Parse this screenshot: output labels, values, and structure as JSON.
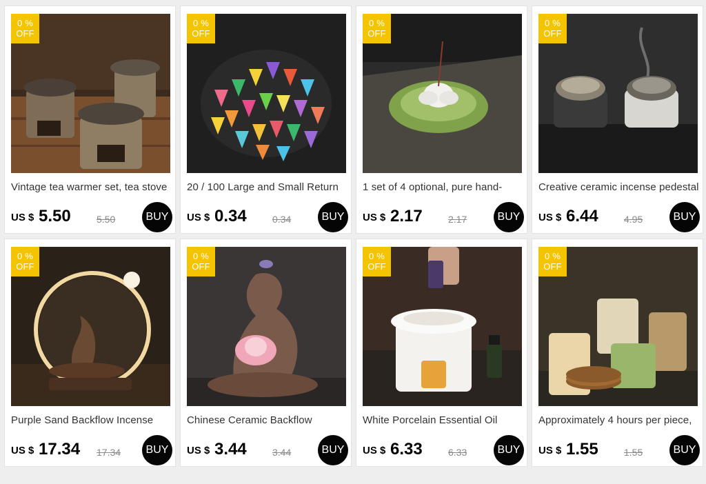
{
  "products": [
    {
      "badge_pct": "0 %",
      "badge_off": "OFF",
      "title": "Vintage tea warmer set, tea stove",
      "currency": "US $",
      "price": "5.50",
      "old_price": "5.50",
      "buy": "BUY",
      "image": "tea-warmer-set-image"
    },
    {
      "badge_pct": "0 %",
      "badge_off": "OFF",
      "title": "20 / 100 Large and Small Return",
      "currency": "US $",
      "price": "0.34",
      "old_price": "0.34",
      "buy": "BUY",
      "image": "incense-cones-image"
    },
    {
      "badge_pct": "0 %",
      "badge_off": "OFF",
      "title": "1 set of 4 optional, pure hand-",
      "currency": "US $",
      "price": "2.17",
      "old_price": "2.17",
      "buy": "BUY",
      "image": "lotus-incense-holder-image"
    },
    {
      "badge_pct": "0 %",
      "badge_off": "OFF",
      "title": "Creative ceramic incense pedestal",
      "currency": "US $",
      "price": "6.44",
      "old_price": "4.95",
      "buy": "BUY",
      "image": "ceramic-incense-burners-image"
    },
    {
      "badge_pct": "0 %",
      "badge_off": "OFF",
      "title": "Purple Sand Backflow Incense",
      "currency": "US $",
      "price": "17.34",
      "old_price": "17.34",
      "buy": "BUY",
      "image": "backflow-incense-lamp-image"
    },
    {
      "badge_pct": "0 %",
      "badge_off": "OFF",
      "title": "Chinese Ceramic Backflow",
      "currency": "US $",
      "price": "3.44",
      "old_price": "3.44",
      "buy": "BUY",
      "image": "ceramic-backflow-lotus-image"
    },
    {
      "badge_pct": "0 %",
      "badge_off": "OFF",
      "title": "White Porcelain Essential Oil",
      "currency": "US $",
      "price": "6.33",
      "old_price": "6.33",
      "buy": "BUY",
      "image": "essential-oil-burner-image"
    },
    {
      "badge_pct": "0 %",
      "badge_off": "OFF",
      "title": "Approximately 4 hours per piece,",
      "currency": "US $",
      "price": "1.55",
      "old_price": "1.55",
      "buy": "BUY",
      "image": "incense-coil-tins-image"
    }
  ],
  "colors": {
    "badge": "#f5c400",
    "buy": "#050505",
    "page": "#eeeeee"
  }
}
